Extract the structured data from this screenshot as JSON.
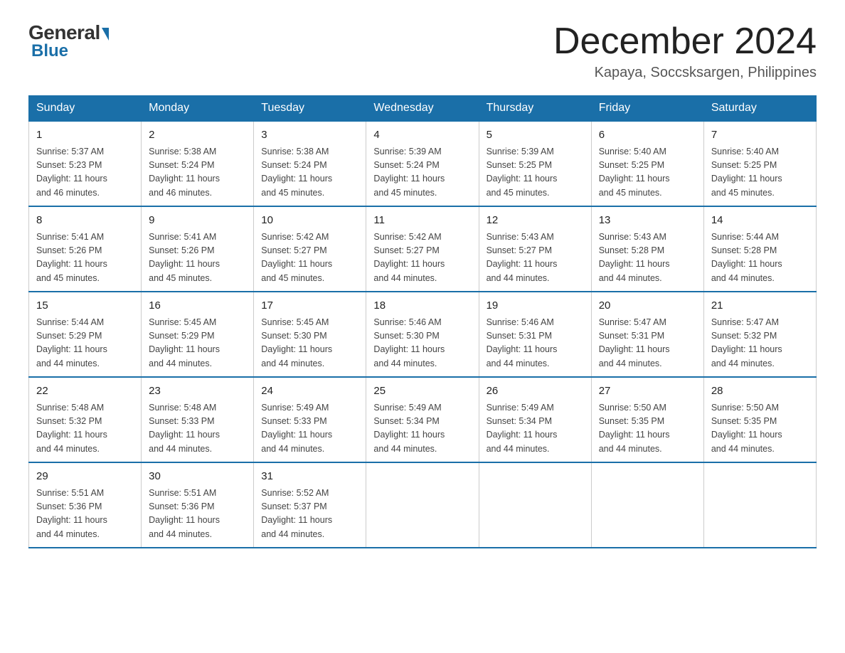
{
  "logo": {
    "general": "General",
    "blue": "Blue"
  },
  "header": {
    "month_year": "December 2024",
    "location": "Kapaya, Soccsksargen, Philippines"
  },
  "days_of_week": [
    "Sunday",
    "Monday",
    "Tuesday",
    "Wednesday",
    "Thursday",
    "Friday",
    "Saturday"
  ],
  "weeks": [
    [
      {
        "day": "1",
        "sunrise": "5:37 AM",
        "sunset": "5:23 PM",
        "daylight": "11 hours and 46 minutes."
      },
      {
        "day": "2",
        "sunrise": "5:38 AM",
        "sunset": "5:24 PM",
        "daylight": "11 hours and 46 minutes."
      },
      {
        "day": "3",
        "sunrise": "5:38 AM",
        "sunset": "5:24 PM",
        "daylight": "11 hours and 45 minutes."
      },
      {
        "day": "4",
        "sunrise": "5:39 AM",
        "sunset": "5:24 PM",
        "daylight": "11 hours and 45 minutes."
      },
      {
        "day": "5",
        "sunrise": "5:39 AM",
        "sunset": "5:25 PM",
        "daylight": "11 hours and 45 minutes."
      },
      {
        "day": "6",
        "sunrise": "5:40 AM",
        "sunset": "5:25 PM",
        "daylight": "11 hours and 45 minutes."
      },
      {
        "day": "7",
        "sunrise": "5:40 AM",
        "sunset": "5:25 PM",
        "daylight": "11 hours and 45 minutes."
      }
    ],
    [
      {
        "day": "8",
        "sunrise": "5:41 AM",
        "sunset": "5:26 PM",
        "daylight": "11 hours and 45 minutes."
      },
      {
        "day": "9",
        "sunrise": "5:41 AM",
        "sunset": "5:26 PM",
        "daylight": "11 hours and 45 minutes."
      },
      {
        "day": "10",
        "sunrise": "5:42 AM",
        "sunset": "5:27 PM",
        "daylight": "11 hours and 45 minutes."
      },
      {
        "day": "11",
        "sunrise": "5:42 AM",
        "sunset": "5:27 PM",
        "daylight": "11 hours and 44 minutes."
      },
      {
        "day": "12",
        "sunrise": "5:43 AM",
        "sunset": "5:27 PM",
        "daylight": "11 hours and 44 minutes."
      },
      {
        "day": "13",
        "sunrise": "5:43 AM",
        "sunset": "5:28 PM",
        "daylight": "11 hours and 44 minutes."
      },
      {
        "day": "14",
        "sunrise": "5:44 AM",
        "sunset": "5:28 PM",
        "daylight": "11 hours and 44 minutes."
      }
    ],
    [
      {
        "day": "15",
        "sunrise": "5:44 AM",
        "sunset": "5:29 PM",
        "daylight": "11 hours and 44 minutes."
      },
      {
        "day": "16",
        "sunrise": "5:45 AM",
        "sunset": "5:29 PM",
        "daylight": "11 hours and 44 minutes."
      },
      {
        "day": "17",
        "sunrise": "5:45 AM",
        "sunset": "5:30 PM",
        "daylight": "11 hours and 44 minutes."
      },
      {
        "day": "18",
        "sunrise": "5:46 AM",
        "sunset": "5:30 PM",
        "daylight": "11 hours and 44 minutes."
      },
      {
        "day": "19",
        "sunrise": "5:46 AM",
        "sunset": "5:31 PM",
        "daylight": "11 hours and 44 minutes."
      },
      {
        "day": "20",
        "sunrise": "5:47 AM",
        "sunset": "5:31 PM",
        "daylight": "11 hours and 44 minutes."
      },
      {
        "day": "21",
        "sunrise": "5:47 AM",
        "sunset": "5:32 PM",
        "daylight": "11 hours and 44 minutes."
      }
    ],
    [
      {
        "day": "22",
        "sunrise": "5:48 AM",
        "sunset": "5:32 PM",
        "daylight": "11 hours and 44 minutes."
      },
      {
        "day": "23",
        "sunrise": "5:48 AM",
        "sunset": "5:33 PM",
        "daylight": "11 hours and 44 minutes."
      },
      {
        "day": "24",
        "sunrise": "5:49 AM",
        "sunset": "5:33 PM",
        "daylight": "11 hours and 44 minutes."
      },
      {
        "day": "25",
        "sunrise": "5:49 AM",
        "sunset": "5:34 PM",
        "daylight": "11 hours and 44 minutes."
      },
      {
        "day": "26",
        "sunrise": "5:49 AM",
        "sunset": "5:34 PM",
        "daylight": "11 hours and 44 minutes."
      },
      {
        "day": "27",
        "sunrise": "5:50 AM",
        "sunset": "5:35 PM",
        "daylight": "11 hours and 44 minutes."
      },
      {
        "day": "28",
        "sunrise": "5:50 AM",
        "sunset": "5:35 PM",
        "daylight": "11 hours and 44 minutes."
      }
    ],
    [
      {
        "day": "29",
        "sunrise": "5:51 AM",
        "sunset": "5:36 PM",
        "daylight": "11 hours and 44 minutes."
      },
      {
        "day": "30",
        "sunrise": "5:51 AM",
        "sunset": "5:36 PM",
        "daylight": "11 hours and 44 minutes."
      },
      {
        "day": "31",
        "sunrise": "5:52 AM",
        "sunset": "5:37 PM",
        "daylight": "11 hours and 44 minutes."
      },
      null,
      null,
      null,
      null
    ]
  ],
  "labels": {
    "sunrise": "Sunrise:",
    "sunset": "Sunset:",
    "daylight": "Daylight:"
  }
}
